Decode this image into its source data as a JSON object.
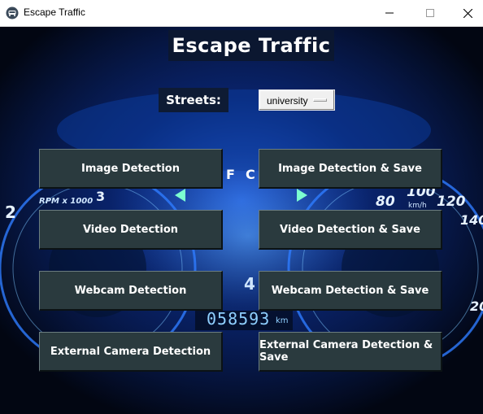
{
  "window": {
    "title": "Escape Traffic"
  },
  "heading": "Escape Traffic",
  "streets": {
    "label": "Streets:",
    "selected": "university"
  },
  "buttons": {
    "image_detection": "Image Detection",
    "image_detection_save": "Image Detection & Save",
    "video_detection": "Video Detection",
    "video_detection_save": "Video Detection & Save",
    "webcam_detection": "Webcam Detection",
    "webcam_detection_save": "Webcam Detection & Save",
    "external_camera_detection": "External Camera Detection",
    "external_camera_detection_save": "External Camera Detection & Save"
  },
  "dashboard": {
    "odometer": "058593",
    "odometer_unit": "km",
    "rpm_label": "RPM x 1000",
    "speed_unit": "km/h",
    "speed_ticks": [
      "80",
      "100",
      "120",
      "140",
      "20"
    ],
    "rpm_ticks": [
      "2",
      "3"
    ],
    "gear_letters": [
      "F",
      "C"
    ],
    "lcd_number": "4"
  },
  "colors": {
    "button_bg": "#2a3a3e",
    "accent_blue": "#1e6bff"
  }
}
